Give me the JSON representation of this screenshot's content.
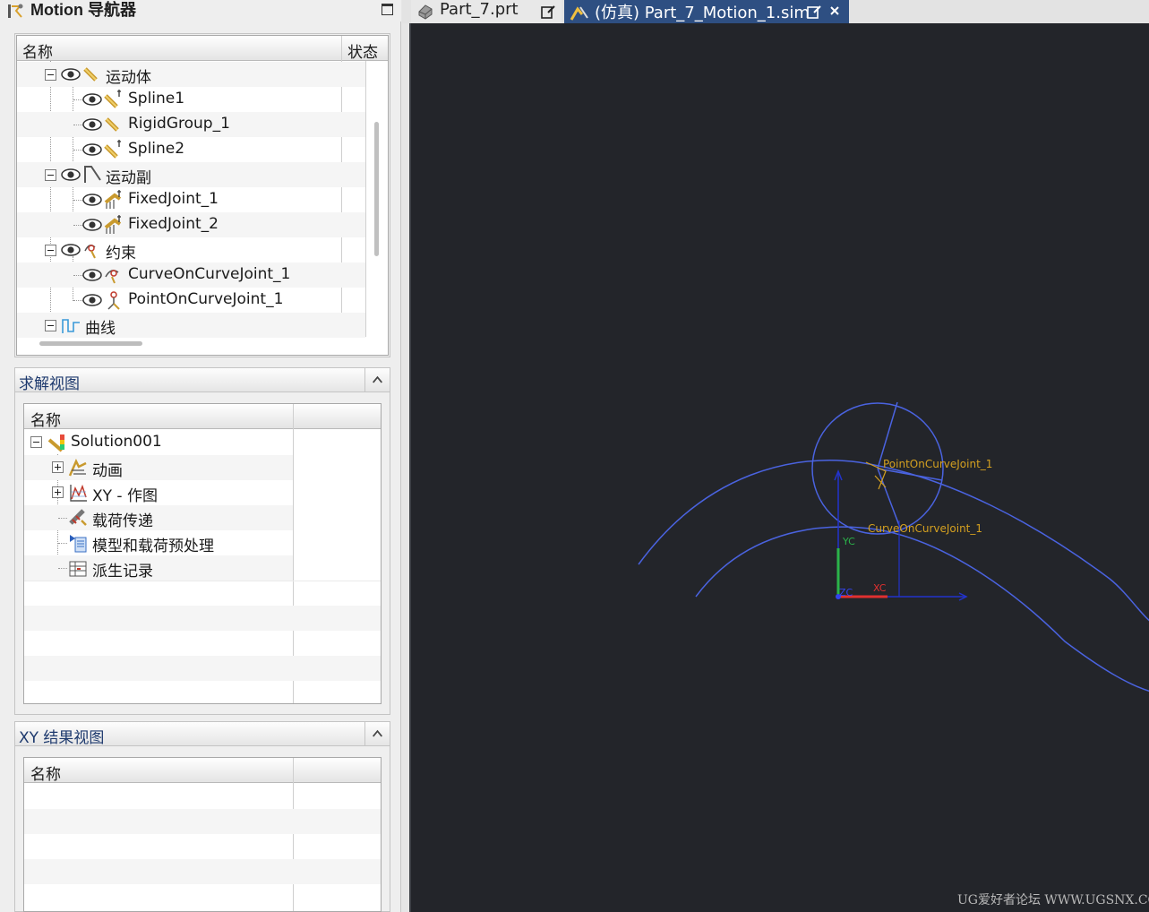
{
  "navigator": {
    "title": "Motion 导航器",
    "columns": {
      "name": "名称",
      "status": "状态"
    },
    "groups": {
      "bodies": {
        "label": "运动体",
        "items": [
          "Spline1",
          "RigidGroup_1",
          "Spline2"
        ]
      },
      "joints": {
        "label": "运动副",
        "items": [
          "FixedJoint_1",
          "FixedJoint_2"
        ]
      },
      "constraints": {
        "label": "约束",
        "items": [
          "CurveOnCurveJoint_1",
          "PointOnCurveJoint_1"
        ]
      },
      "curves": {
        "label": "曲线"
      }
    }
  },
  "solution_view": {
    "title": "求解视图",
    "column": "名称",
    "root": "Solution001",
    "items": [
      "动画",
      "XY - 作图",
      "载荷传递",
      "模型和载荷预处理",
      "派生记录"
    ]
  },
  "xy_view": {
    "title": "XY 结果视图",
    "column": "名称"
  },
  "tabs": {
    "part": "Part_7.prt",
    "sim": "(仿真) Part_7_Motion_1.sim"
  },
  "viewport": {
    "labels": {
      "point_on_curve": "PointOnCurveJoint_1",
      "curve_on_curve": "CurveOnCurveJoint_1",
      "yc": "YC",
      "xc": "XC",
      "zc": "ZC"
    },
    "watermark": "UG爱好者论坛 WWW.UGSNX.COM",
    "colors": {
      "background": "#23252a",
      "curve": "#4a63e0",
      "label": "#d4a020",
      "xc": "#e03030",
      "yc": "#2bb34a"
    }
  }
}
